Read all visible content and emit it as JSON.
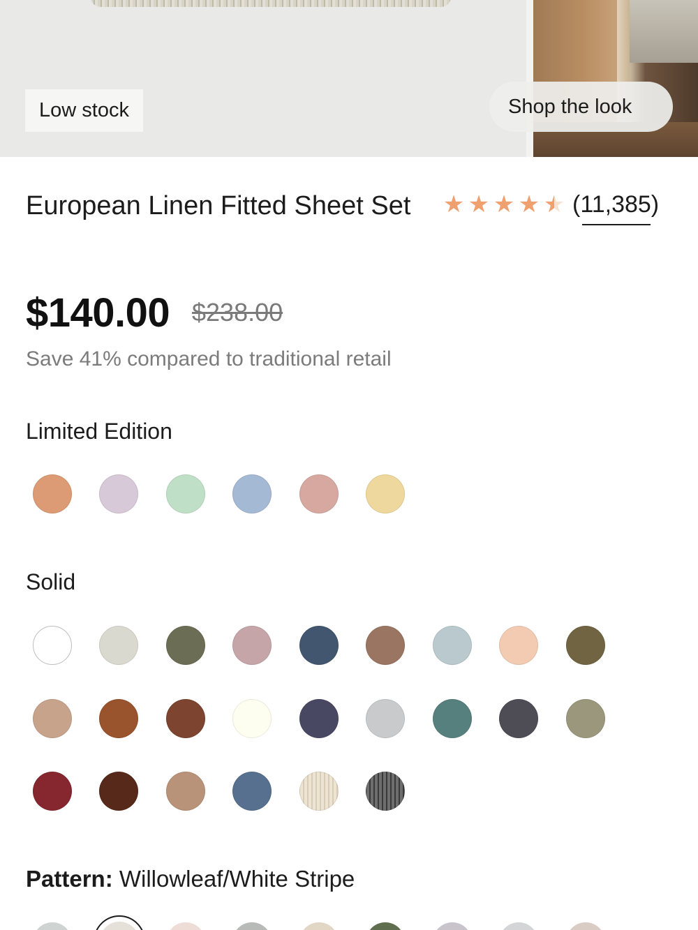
{
  "hero": {
    "badge": "Low stock",
    "shop_button": "Shop the look"
  },
  "product": {
    "title": "European Linen Fitted Sheet Set",
    "rating": 4.5,
    "reviews": "(11,385)",
    "price": "$140.00",
    "original_price": "$238.00",
    "savings": "Save 41% compared to traditional retail"
  },
  "limited_edition": {
    "label": "Limited Edition",
    "colors": [
      "#dc9b74",
      "#d7c9d7",
      "#bfe0c6",
      "#a4b9d3",
      "#d7a8a0",
      "#efd89d"
    ]
  },
  "solid": {
    "label": "Solid",
    "rows": [
      [
        "#ffffff",
        "#d9d9cf",
        "#6b6d54",
        "#c6a5a9",
        "#425670",
        "#9a7561",
        "#b9c9cd",
        "#f2cbb2",
        "#706443"
      ],
      [
        "#c8a38c",
        "#99532d",
        "#7d4430",
        "#fdfdf0",
        "#494862",
        "#c9cacc",
        "#56807d",
        "#4e4d55",
        "#9a977c"
      ],
      [
        "#86262f",
        "#57291b",
        "#b99379",
        "#57708f",
        "stripe-cream",
        "stripe-grey"
      ]
    ]
  },
  "pattern": {
    "label": "Pattern:",
    "value": "Willowleaf/White Stripe",
    "swatches": [
      "#cfd3d1",
      "#e5e0d8",
      "#eedcd6",
      "#b7bab6",
      "#e2d6c4",
      "#5e6e4e",
      "#c9c4cc",
      "#d3d5d6",
      "#d9ccc4"
    ]
  }
}
